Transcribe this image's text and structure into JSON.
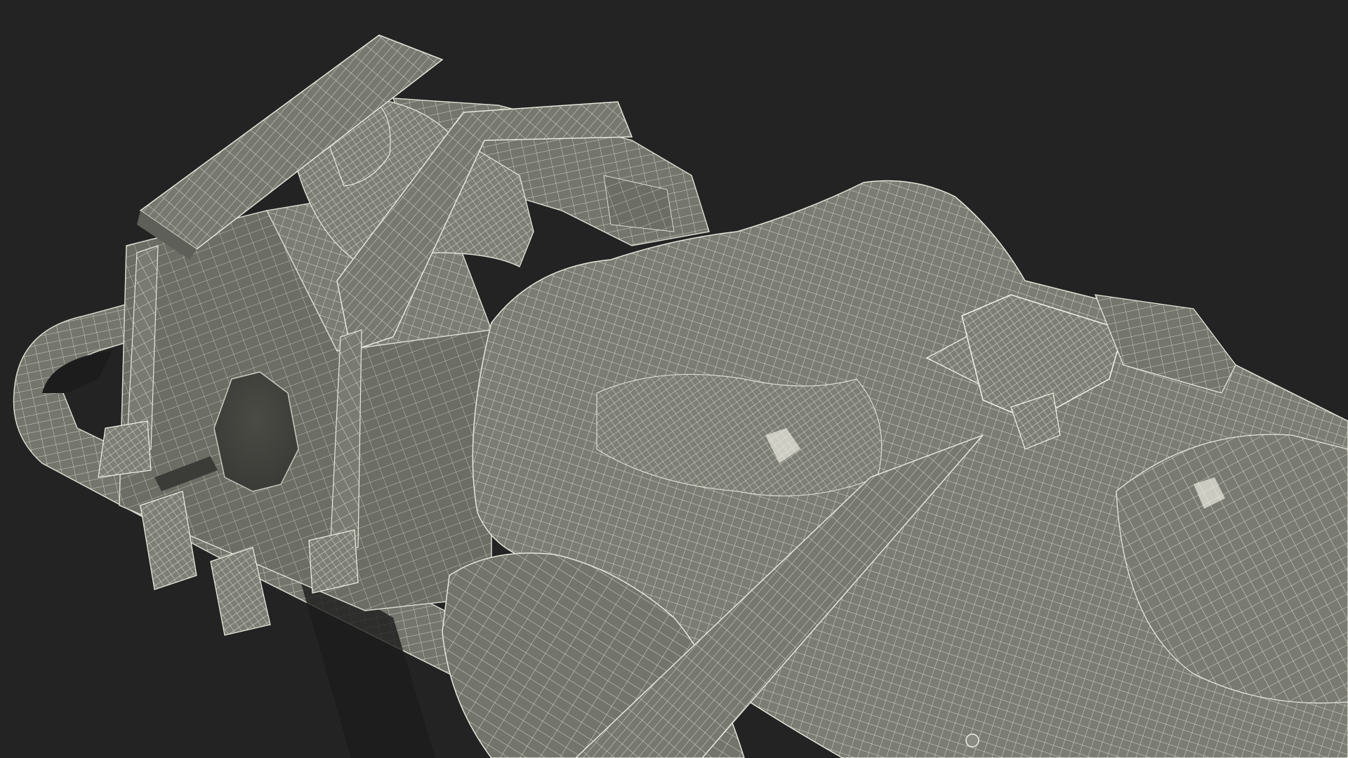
{
  "scene": {
    "subject": "wireframe-3d-render",
    "colors": {
      "background": "#232323",
      "surface": "#7a7b72",
      "surface_dark": "#63645d",
      "surface_light": "#8a8b82",
      "wire": "#e6e6dc",
      "strap": "#74756c"
    }
  }
}
